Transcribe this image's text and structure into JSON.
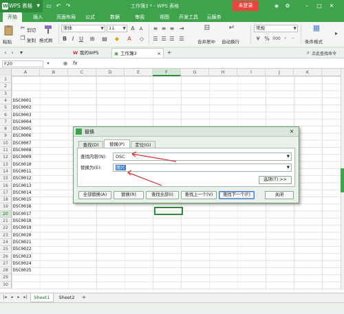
{
  "app": {
    "name": "WPS 表格",
    "title": "工作簿3 * - WPS 表格",
    "login": "未登录"
  },
  "menu_tabs": [
    "开始",
    "插入",
    "页面布局",
    "公式",
    "数据",
    "审阅",
    "视图",
    "开发工具",
    "云服务"
  ],
  "ribbon": {
    "paste": "粘贴",
    "cut": "剪切",
    "copy": "复制",
    "format_painter": "格式刷",
    "font_name": "宋体",
    "font_size": "11",
    "merge": "合并居中",
    "wrap": "自动换行",
    "number_format": "常规",
    "cond_format": "条件格式"
  },
  "doc_tabs": {
    "mywps": "我的WPS",
    "workbook": "工作簿3",
    "quick": "点此查找命令"
  },
  "formula_bar": {
    "cell_ref": "F20",
    "fx": "fx"
  },
  "columns": [
    "A",
    "B",
    "C",
    "D",
    "E",
    "F",
    "G",
    "H",
    "I",
    "J",
    "K"
  ],
  "selected_column": "F",
  "rows": [
    "1",
    "2",
    "3",
    "4",
    "5",
    "6",
    "7",
    "8",
    "9",
    "10",
    "11",
    "12",
    "13",
    "14",
    "15",
    "16",
    "17",
    "18",
    "19",
    "20",
    "21",
    "22",
    "23",
    "24",
    "25",
    "26",
    "27",
    "28",
    "29",
    "30"
  ],
  "selected_row": "20",
  "cells_A": [
    "",
    "",
    "",
    "DSC0001",
    "DSC0002",
    "DSC0003",
    "DSC0004",
    "DSC0005",
    "DSC0006",
    "DSC0007",
    "DSC0008",
    "DSC0009",
    "DSC0010",
    "DSC0011",
    "DSC0012",
    "DSC0013",
    "DSC0014",
    "DSC0015",
    "DSC0016",
    "DSC0017",
    "DSC0018",
    "DSC0019",
    "DSC0020",
    "DSC0021",
    "DSC0022",
    "DSC0023",
    "DSC0024",
    "DSC0025",
    "",
    ""
  ],
  "sheets": [
    "Sheet1",
    "Sheet2"
  ],
  "dialog": {
    "title": "替换",
    "tabs": [
      "查找(D)",
      "替换(P)",
      "定位(G)"
    ],
    "find_label": "查找内容(N):",
    "find_value": "DSC",
    "replace_label": "替换为(E):",
    "replace_value": "图片",
    "options": "选项(T) >>",
    "buttons": [
      "全部替换(A)",
      "替换(R)",
      "查找全部(I)",
      "查找上一个(V)",
      "查找下一个(F)",
      "关闭"
    ]
  },
  "colors": {
    "wps_green": "#3fa34d",
    "dark_green": "#2f8a3c",
    "login_red": "#e8453c",
    "arrow_red": "#d42a2a"
  }
}
